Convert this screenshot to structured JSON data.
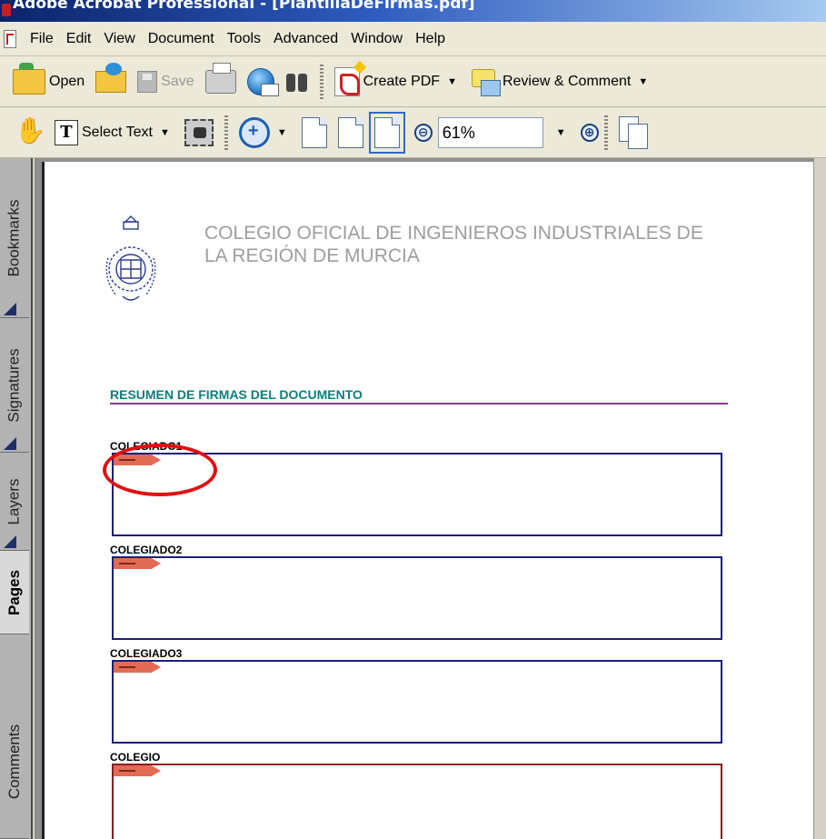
{
  "window": {
    "title": "Adobe Acrobat Professional - [PlantillaDeFirmas.pdf]"
  },
  "menubar": {
    "items": [
      "File",
      "Edit",
      "View",
      "Document",
      "Tools",
      "Advanced",
      "Window",
      "Help"
    ]
  },
  "toolbar1": {
    "open_label": "Open",
    "save_label": "Save",
    "create_pdf_label": "Create PDF",
    "review_label": "Review & Comment"
  },
  "toolbar2": {
    "select_text_label": "Select Text",
    "zoom_minus": "⊖",
    "zoom_plus": "⊕",
    "zoom_value": "61%"
  },
  "nav_panel": {
    "tabs": [
      "Bookmarks",
      "Signatures",
      "Layers",
      "Pages",
      "Comments"
    ],
    "active_tab": "Pages"
  },
  "document": {
    "org_title_line1": "COLEGIO OFICIAL DE INGENIEROS INDUSTRIALES DE",
    "org_title_line2": "LA REGIÓN DE MURCIA",
    "summary_title": "RESUMEN DE FIRMAS DEL DOCUMENTO",
    "signatures": [
      {
        "label": "COLEGIADO1"
      },
      {
        "label": "COLEGIADO2"
      },
      {
        "label": "COLEGIADO3"
      },
      {
        "label": "COLEGIO"
      }
    ]
  },
  "colors": {
    "accent_teal": "#0e7d7d",
    "rule_purple": "#8b3a8b",
    "box_blue": "#1a1f7a",
    "box_red": "#8b1e1e",
    "annotation_red": "#e01010"
  }
}
